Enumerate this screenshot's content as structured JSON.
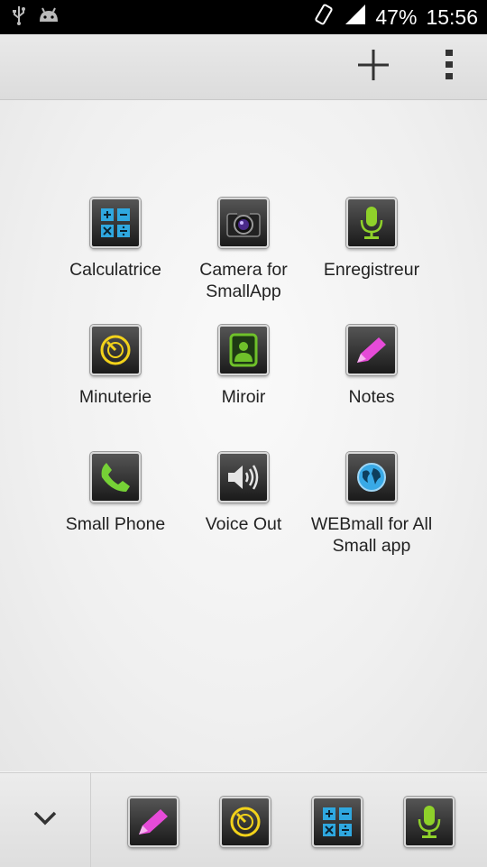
{
  "status_bar": {
    "battery": "47%",
    "time": "15:56",
    "icons": [
      "usb-icon",
      "android-debug-icon",
      "rotation-icon",
      "signal-icon"
    ]
  },
  "action_bar": {
    "icons": [
      "plus-icon",
      "overflow-menu-icon"
    ]
  },
  "apps": [
    {
      "label": "Calculatrice",
      "icon": "calculator-icon"
    },
    {
      "label": "Camera for SmallApp",
      "icon": "camera-icon"
    },
    {
      "label": "Enregistreur",
      "icon": "microphone-icon"
    },
    {
      "label": "Minuterie",
      "icon": "timer-icon"
    },
    {
      "label": "Miroir",
      "icon": "mirror-icon"
    },
    {
      "label": "Notes",
      "icon": "pencil-icon"
    },
    {
      "label": "Small Phone",
      "icon": "phone-icon"
    },
    {
      "label": "Voice Out",
      "icon": "speaker-icon"
    },
    {
      "label": "WEBmall for All Small app",
      "icon": "globe-icon"
    }
  ],
  "dock": {
    "collapse_icon": "chevron-down-icon",
    "items": [
      "pencil-icon",
      "timer-icon",
      "calculator-icon",
      "microphone-icon"
    ]
  },
  "colors": {
    "calculator": "#2fa8e0",
    "microphone": "#8fd12a",
    "timer": "#f2d21a",
    "pencil": "#e64bd8",
    "phone": "#76d136",
    "globe": "#39a9e6"
  }
}
